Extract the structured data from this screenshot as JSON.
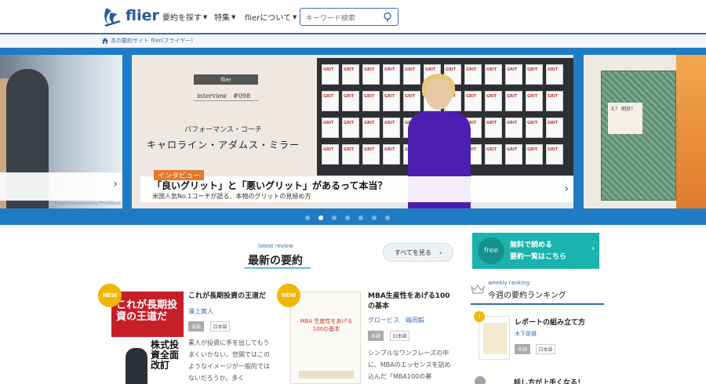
{
  "header": {
    "logo_text": "flier",
    "nav": [
      {
        "label": "要約を探す"
      },
      {
        "label": "特集"
      },
      {
        "label": "flierについて"
      }
    ],
    "search_placeholder": "キーワード検索"
  },
  "breadcrumb": {
    "label": "本の要約サイト flier(フライヤー)"
  },
  "carousel": {
    "main": {
      "badge": "flier",
      "interview": "interview　#098",
      "pretitle": "パフォーマンス・コーチ",
      "name": "キャロライン・アダムス・ミラー",
      "tag": "インタビュー",
      "title": "「良いグリット」と「悪いグリット」があるって本当？",
      "subtitle": "米国人気No.1コーチが語る、本物のグリットの見極め方"
    },
    "left_credit": "Flickr/Comstock/Getty/ThinkStock",
    "right_book_label": "え？ 明日？",
    "dots_count": 7,
    "active_dot": 1
  },
  "latest_review": {
    "sub": "latest review",
    "title": "最新の要約",
    "see_all": "すべてを見る"
  },
  "cards": [
    {
      "badge": "NEW",
      "cover_title": "これが長期投資の王道だ",
      "cover_big": "株式投資全面改訂",
      "title": "これが長期投資の王道だ",
      "author": "澤上篤人",
      "tag": "未読",
      "lang": "日本語",
      "desc": "素人が投資に手を出してもうまくいかない。世間ではこのようなイメージが一般的ではないだろうか。多く"
    },
    {
      "badge": "NEW",
      "cover_title": "MBA 生産性をあげる100の基本",
      "title": "MBA生産性をあげる100の基本",
      "author": "グロービス　嶋田毅",
      "tag": "未読",
      "lang": "日本語",
      "desc": "シンプルなワンフレーズの中に、MBAのエッセンスを詰め込んだ「MBA100の基"
    }
  ],
  "sidebar": {
    "free_circle": "free",
    "free_line1": "無料で読める",
    "free_line2": "要約一覧はこちら",
    "ranking_sub": "weekly ranking",
    "ranking_title": "今週の要約ランキング",
    "rank1": {
      "title": "レポートの組み立て方",
      "author": "木下是雄",
      "tag": "未読",
      "lang": "日本語"
    },
    "rank2_title": "話し方が上手くなる！"
  },
  "colors": {
    "brand_blue": "#2a5aa3",
    "carousel_blue": "#1f7cc4",
    "teal": "#1ab3ad",
    "orange_tag": "#e8772e",
    "new_badge": "#f2b705"
  }
}
